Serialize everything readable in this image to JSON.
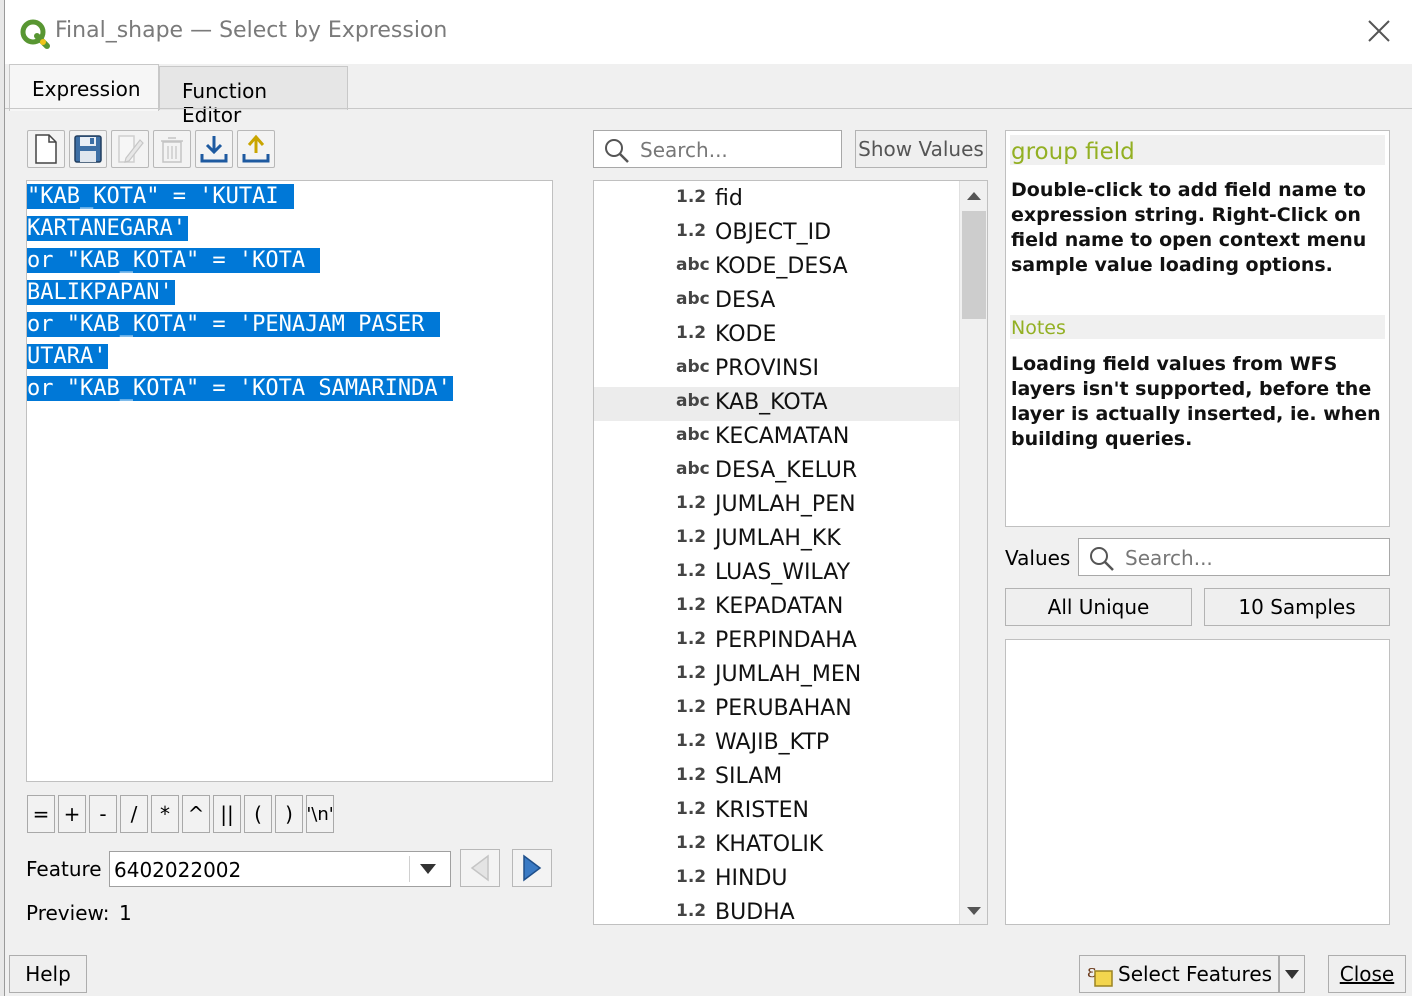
{
  "window": {
    "title": "Final_shape — Select by Expression"
  },
  "tabs": [
    {
      "label": "Expression",
      "active": true
    },
    {
      "label": "Function Editor",
      "active": false
    }
  ],
  "toolbar": {
    "icons": [
      "new-file-icon",
      "save-icon",
      "edit-icon",
      "delete-icon",
      "import-icon",
      "export-icon"
    ]
  },
  "editor": {
    "lines": [
      "\"KAB_KOTA\" = 'KUTAI ",
      "KARTANEGARA'",
      "or \"KAB_KOTA\" = 'KOTA ",
      "BALIKPAPAN'",
      "or \"KAB_KOTA\" = 'PENAJAM PASER ",
      "UTARA'",
      "or \"KAB_KOTA\" = 'KOTA SAMARINDA'"
    ]
  },
  "operators": [
    "=",
    "+",
    "-",
    "/",
    "*",
    "^",
    "||",
    "(",
    ")",
    "'\\n'"
  ],
  "feature": {
    "label": "Feature",
    "value": "6402022002"
  },
  "preview": {
    "label": "Preview:",
    "value": "1"
  },
  "search": {
    "placeholder": "Search...",
    "show_values_label": "Show Values"
  },
  "fields": [
    {
      "type": "1.2",
      "name": "fid"
    },
    {
      "type": "1.2",
      "name": "OBJECT_ID"
    },
    {
      "type": "abc",
      "name": "KODE_DESA"
    },
    {
      "type": "abc",
      "name": "DESA"
    },
    {
      "type": "1.2",
      "name": "KODE"
    },
    {
      "type": "abc",
      "name": "PROVINSI"
    },
    {
      "type": "abc",
      "name": "KAB_KOTA",
      "selected": true
    },
    {
      "type": "abc",
      "name": "KECAMATAN"
    },
    {
      "type": "abc",
      "name": "DESA_KELUR"
    },
    {
      "type": "1.2",
      "name": "JUMLAH_PEN"
    },
    {
      "type": "1.2",
      "name": "JUMLAH_KK"
    },
    {
      "type": "1.2",
      "name": "LUAS_WILAY"
    },
    {
      "type": "1.2",
      "name": "KEPADATAN"
    },
    {
      "type": "1.2",
      "name": "PERPINDAHA"
    },
    {
      "type": "1.2",
      "name": "JUMLAH_MEN"
    },
    {
      "type": "1.2",
      "name": "PERUBAHAN"
    },
    {
      "type": "1.2",
      "name": "WAJIB_KTP"
    },
    {
      "type": "1.2",
      "name": "SILAM"
    },
    {
      "type": "1.2",
      "name": "KRISTEN"
    },
    {
      "type": "1.2",
      "name": "KHATOLIK"
    },
    {
      "type": "1.2",
      "name": "HINDU"
    },
    {
      "type": "1.2",
      "name": "BUDHA"
    }
  ],
  "help": {
    "heading": "group field",
    "body": "Double-click to add field name to expression string. Right-Click on field name to open context menu sample value loading options.",
    "notes_heading": "Notes",
    "notes_body": "Loading field values from WFS layers isn't supported, before the layer is actually inserted, ie. when building queries."
  },
  "values": {
    "label": "Values",
    "search_placeholder": "Search...",
    "all_unique_label": "All Unique",
    "samples_label": "10 Samples"
  },
  "buttons": {
    "help": "Help",
    "select_features": "Select Features",
    "close": "Close"
  },
  "colors": {
    "selection": "#0078d7",
    "help_heading": "#93b023",
    "qgis_green": "#589632"
  }
}
